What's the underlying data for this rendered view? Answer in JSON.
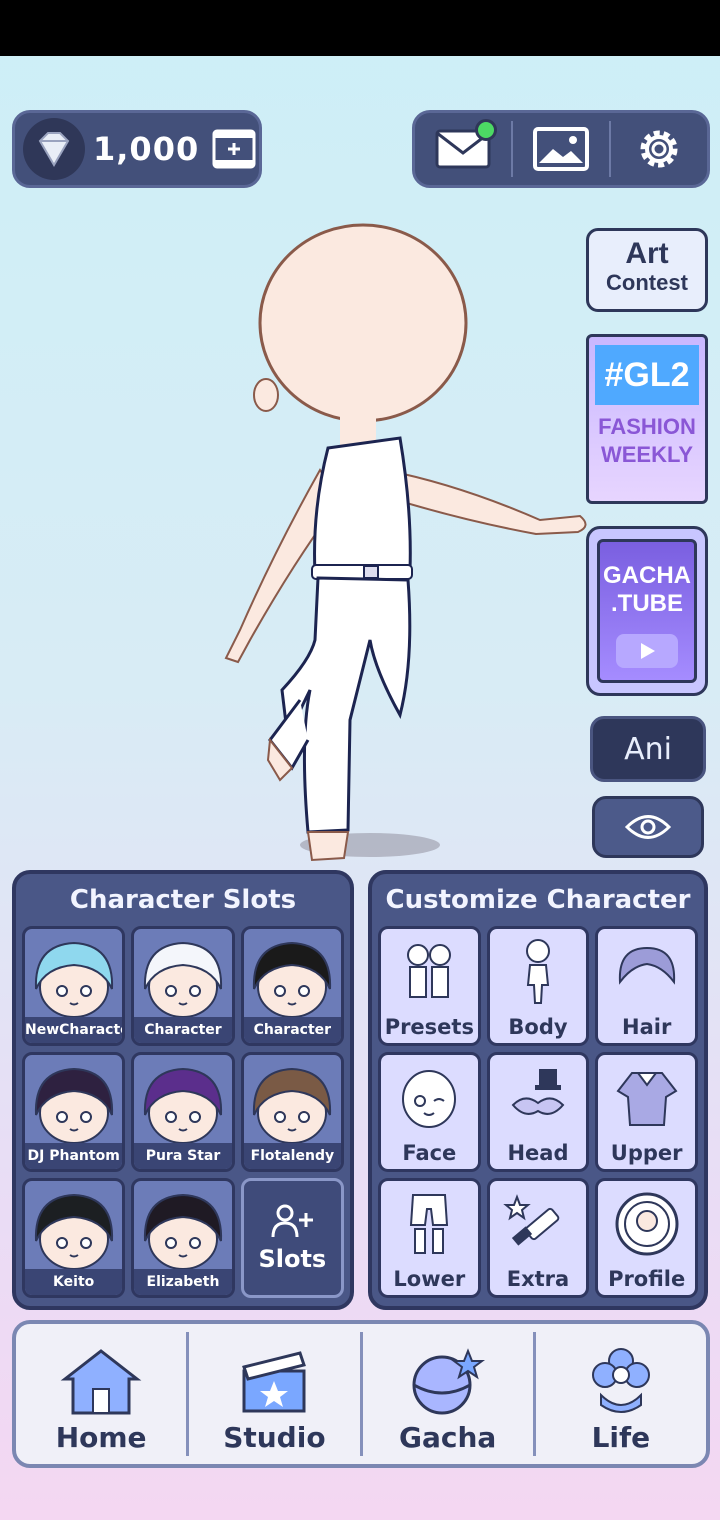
{
  "currency": {
    "gems": "1,000"
  },
  "top_bar": {
    "mail_has_notification": true
  },
  "side_widgets": {
    "art_contest": {
      "line1": "Art",
      "line2": "Contest"
    },
    "gl2": {
      "hashtag": "#GL2",
      "line1": "FASHION",
      "line2": "WEEKLY"
    },
    "gacha_tube": {
      "line1": "GACHA",
      "line2": ".TUBE"
    },
    "ani_label": "Ani"
  },
  "character_slots": {
    "title": "Character Slots",
    "slots": [
      {
        "name": "NewCharacter",
        "hair": "#8fd8ee"
      },
      {
        "name": "Character",
        "hair": "#f4f6fb"
      },
      {
        "name": "Character",
        "hair": "#1a1a1a"
      },
      {
        "name": "DJ Phantom",
        "hair": "#2e2140"
      },
      {
        "name": "Pura Star",
        "hair": "#5b2e8c"
      },
      {
        "name": "Flotalendy",
        "hair": "#7a5a45"
      },
      {
        "name": "Keito",
        "hair": "#1c1f22"
      },
      {
        "name": "Elizabeth",
        "hair": "#1f1a24"
      }
    ],
    "add_label": "Slots"
  },
  "customize": {
    "title": "Customize Character",
    "items": [
      {
        "label": "Presets",
        "icon": "presets-icon"
      },
      {
        "label": "Body",
        "icon": "body-icon"
      },
      {
        "label": "Hair",
        "icon": "hair-icon"
      },
      {
        "label": "Face",
        "icon": "face-icon"
      },
      {
        "label": "Head",
        "icon": "head-icon"
      },
      {
        "label": "Upper",
        "icon": "upper-icon"
      },
      {
        "label": "Lower",
        "icon": "lower-icon"
      },
      {
        "label": "Extra",
        "icon": "extra-icon"
      },
      {
        "label": "Profile",
        "icon": "profile-icon"
      }
    ]
  },
  "nav": {
    "items": [
      {
        "label": "Home"
      },
      {
        "label": "Studio"
      },
      {
        "label": "Gacha"
      },
      {
        "label": "Life"
      }
    ]
  }
}
